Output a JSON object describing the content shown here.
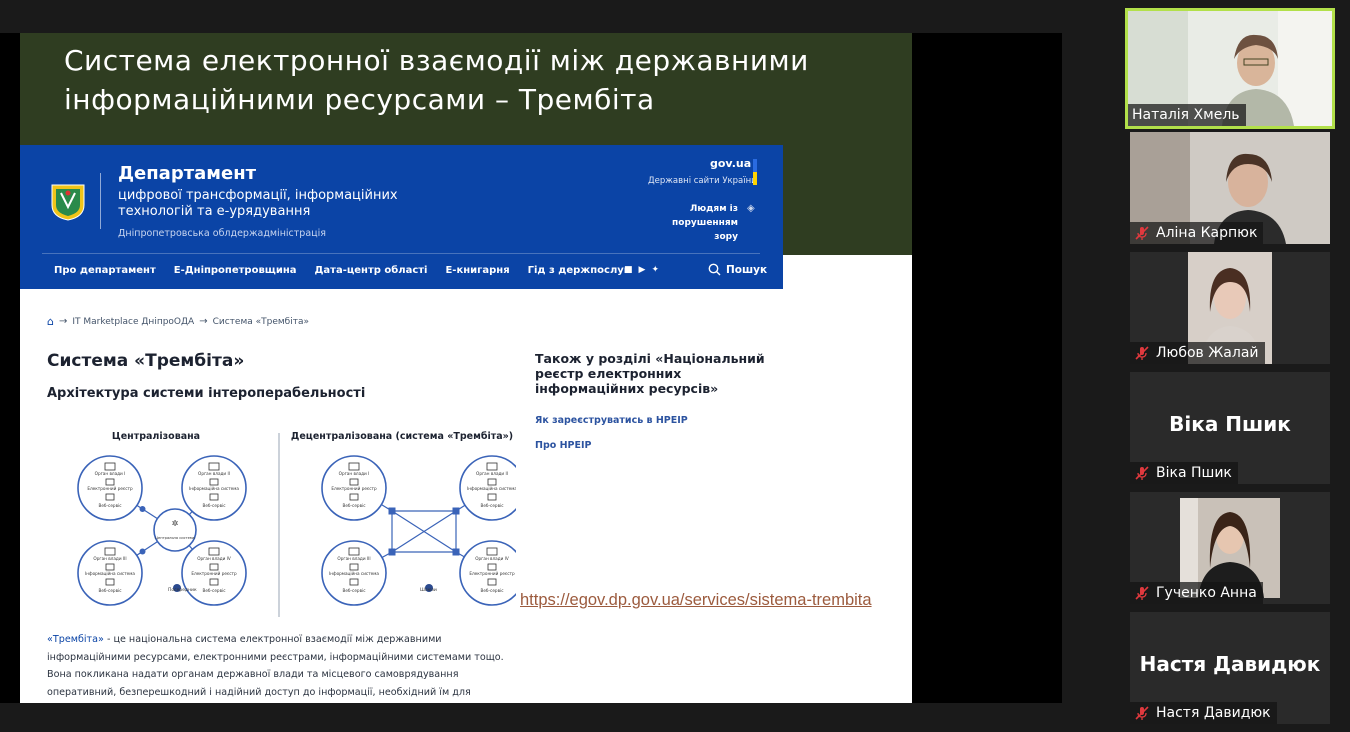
{
  "slide": {
    "title": "Система електронної взаємодії між державними\nінформаційними ресурсами – Трембіта"
  },
  "site": {
    "dept_title": "Департамент",
    "dept_sub": "цифрової трансформації, інформаційних\nтехнологій та е-урядування",
    "dept_region": "Дніпропетровська облдержадміністрація",
    "govua": "gov.ua",
    "govua_sub": "Державні сайти України",
    "accessibility": "Людям із порушенням\nзору",
    "nav": [
      "Про департамент",
      "Е-Дніпропетровщина",
      "Дата-центр області",
      "Е-книгарня",
      "Гід з держпослуг"
    ],
    "search_label": "Пошук",
    "icons": {
      "home": "home-icon",
      "search": "search-icon",
      "accessibility": "eye-icon"
    }
  },
  "breadcrumb": [
    "IT Marketplace ДніпроОДА",
    "Система «Трембіта»"
  ],
  "page": {
    "h1": "Система «Трембіта»",
    "h2": "Архітектура системи інтероперабельності"
  },
  "diagram": {
    "left_title": "Централізована",
    "right_title": "Децентралізована (система «Трембіта»)",
    "center_label": "Центральна система",
    "left_legend": "Посередник",
    "right_legend": "Шлюзи",
    "nodes": [
      {
        "org": "Орган влади I",
        "sys1": "Електронний реєстр",
        "sys2": "Веб-сервіс"
      },
      {
        "org": "Орган влади II",
        "sys1": "Інформаційна система",
        "sys2": "Веб-сервіс"
      },
      {
        "org": "Орган влади III",
        "sys1": "Інформаційна система",
        "sys2": "Веб-сервіс"
      },
      {
        "org": "Орган влади IV",
        "sys1": "Електронний реєстр",
        "sys2": "Веб-сервіс"
      }
    ]
  },
  "description": {
    "link": "«Трембіта»",
    "text": " - це національна система електронної взаємодії між державними інформаційними ресурсами, електронними реєстрами, інформаційними системами тощо. Вона покликана надати органам державної влади та місцевого самоврядування оперативний, безперешкодний і надійний доступ до інформації, необхідний їм для здійснення їх повноважень."
  },
  "also": {
    "title": "Також у розділі «Національний\nреєстр електронних\nінформаційних ресурсів»",
    "link1": "Як зареєструватись в НРЕІР",
    "link2": "Про НРЕІР"
  },
  "url": "https://egov.dp.gov.ua/services/sistema-trembita",
  "participants": [
    {
      "name": "Наталія Хмель",
      "muted": false,
      "video": true
    },
    {
      "name": "Аліна Карпюк",
      "muted": true,
      "video": true
    },
    {
      "name": "Любов Жалай",
      "muted": true,
      "video": true
    },
    {
      "name": "Віка Пшик",
      "muted": true,
      "video": false
    },
    {
      "name": "Гученко Анна",
      "muted": true,
      "video": true
    },
    {
      "name": "Настя Давидюк",
      "muted": true,
      "video": false
    }
  ],
  "colors": {
    "slide_header": "#2f3d21",
    "site_header": "#0b44a6",
    "active_speaker": "#b2e04a",
    "muted_icon": "#e0393e",
    "url": "#9c5b3e"
  }
}
